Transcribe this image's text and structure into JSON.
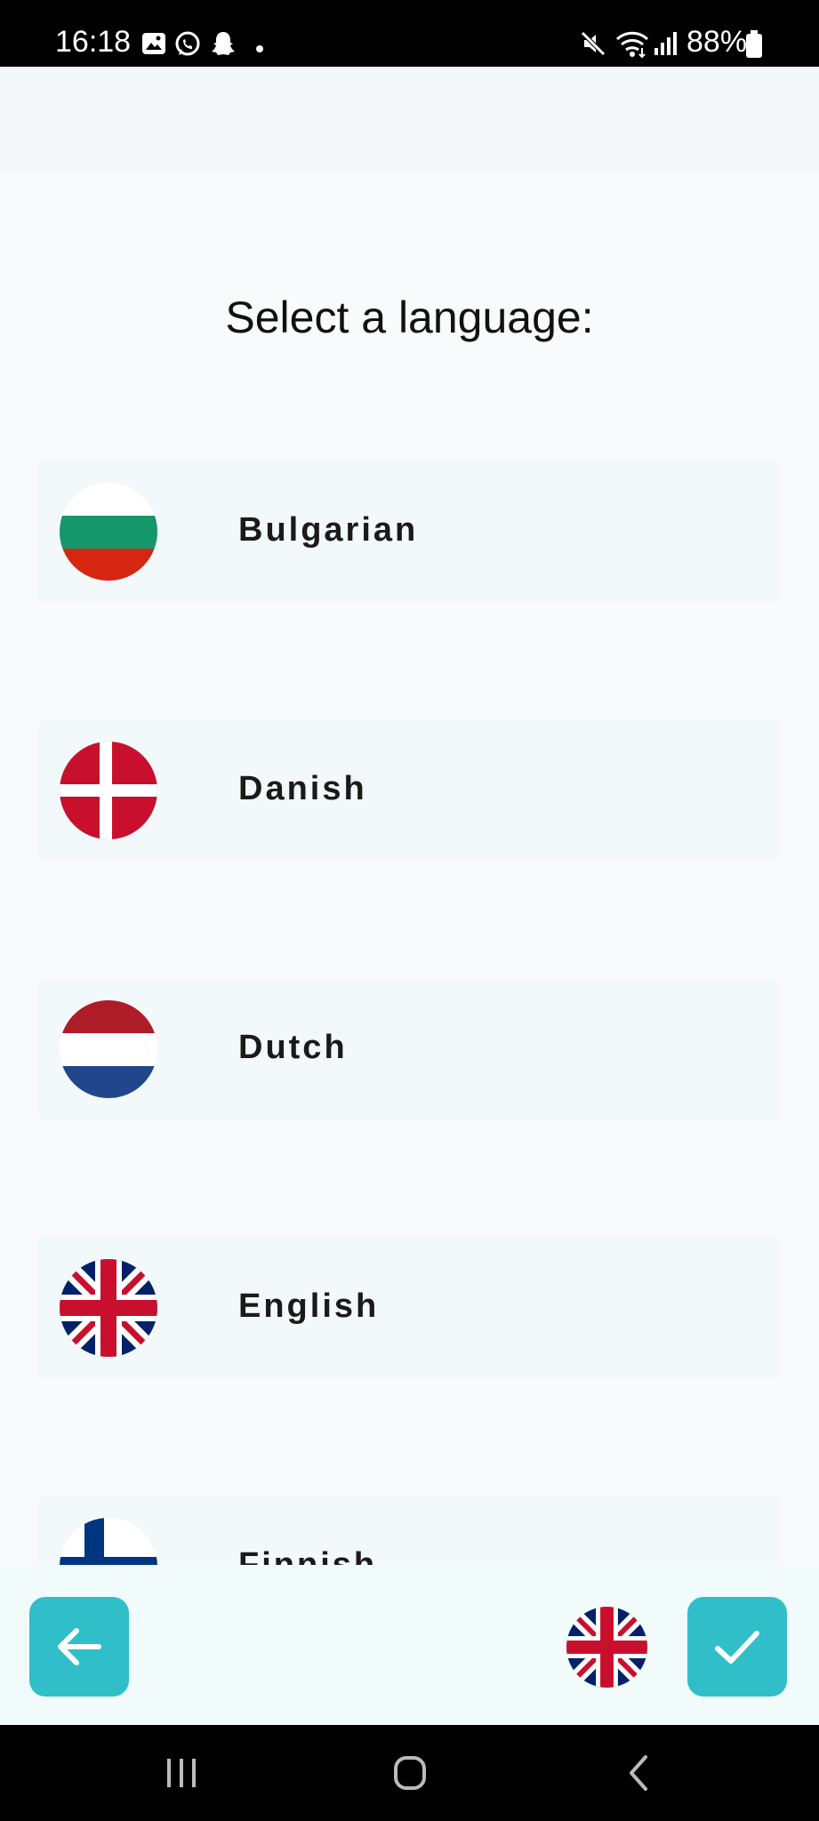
{
  "status_bar": {
    "time": "16:18",
    "battery_percent": "88%",
    "left_icons": [
      "gallery-icon",
      "whatsapp-icon",
      "snapchat-icon",
      "dot-icon"
    ],
    "right_icons": [
      "mute-icon",
      "wifi-icon",
      "signal-icon",
      "battery-icon"
    ]
  },
  "page": {
    "title": "Select a language:"
  },
  "languages": [
    {
      "label": "Bulgarian",
      "flag": "bulgaria-flag-icon"
    },
    {
      "label": "Danish",
      "flag": "denmark-flag-icon"
    },
    {
      "label": "Dutch",
      "flag": "netherlands-flag-icon"
    },
    {
      "label": "English",
      "flag": "uk-flag-icon"
    },
    {
      "label": "Finnish",
      "flag": "finland-flag-icon"
    }
  ],
  "bottom_bar": {
    "back_icon": "arrow-left-icon",
    "current_language_flag": "uk-flag-icon",
    "confirm_icon": "checkmark-icon"
  },
  "nav_bar": {
    "icons": [
      "recents-icon",
      "home-icon",
      "back-icon"
    ]
  },
  "colors": {
    "accent": "#30bfc9",
    "background": "#f9fafb",
    "row_background": "#f3f8fb",
    "bottom_bar_background": "#f1fbfc"
  }
}
